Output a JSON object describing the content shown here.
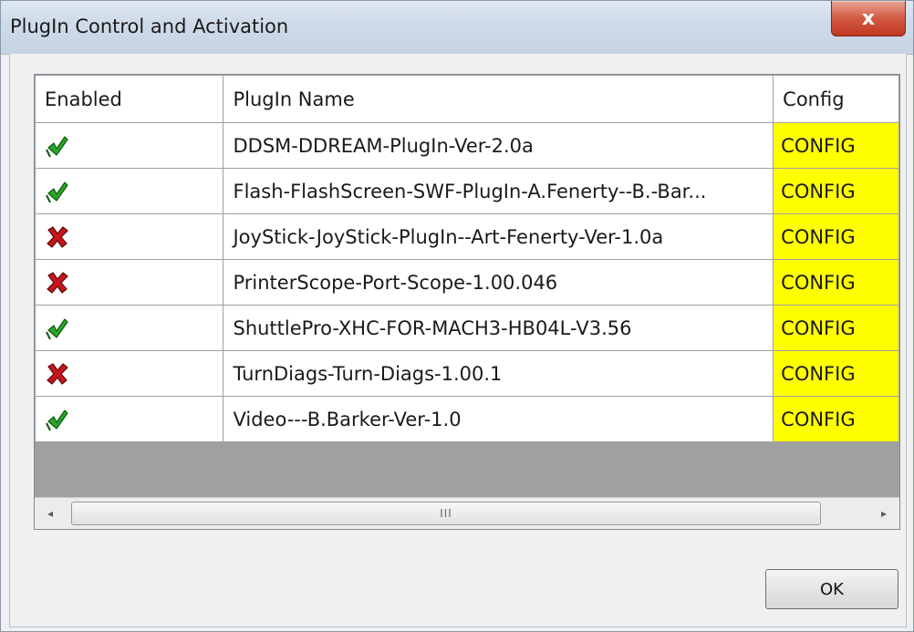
{
  "window": {
    "title": "PlugIn Control and Activation",
    "close_label": "x"
  },
  "table": {
    "headers": [
      "Enabled",
      "PlugIn Name",
      "Config"
    ],
    "rows": [
      {
        "enabled": true,
        "name": "DDSM-DDREAM-PlugIn-Ver-2.0a",
        "config": "CONFIG"
      },
      {
        "enabled": true,
        "name": "Flash-FlashScreen-SWF-PlugIn-A.Fenerty--B.-Bar...",
        "config": "CONFIG"
      },
      {
        "enabled": false,
        "name": "JoyStick-JoyStick-PlugIn--Art-Fenerty-Ver-1.0a",
        "config": "CONFIG"
      },
      {
        "enabled": false,
        "name": "PrinterScope-Port-Scope-1.00.046",
        "config": "CONFIG"
      },
      {
        "enabled": true,
        "name": "ShuttlePro-XHC-FOR-MACH3-HB04L-V3.56",
        "config": "CONFIG"
      },
      {
        "enabled": false,
        "name": "TurnDiags-Turn-Diags-1.00.1",
        "config": "CONFIG"
      },
      {
        "enabled": true,
        "name": "Video---B.Barker-Ver-1.0",
        "config": "CONFIG"
      }
    ]
  },
  "scrollbar": {
    "left_arrow": "◂",
    "right_arrow": "▸",
    "grip": "III"
  },
  "buttons": {
    "ok_label": "OK"
  },
  "colors": {
    "enabled_icon": "#2aa52a",
    "disabled_icon": "#c8141c",
    "config_cell": "#ffff00"
  },
  "icons": {
    "enabled": "check-flag-icon",
    "disabled": "x-flag-icon"
  }
}
